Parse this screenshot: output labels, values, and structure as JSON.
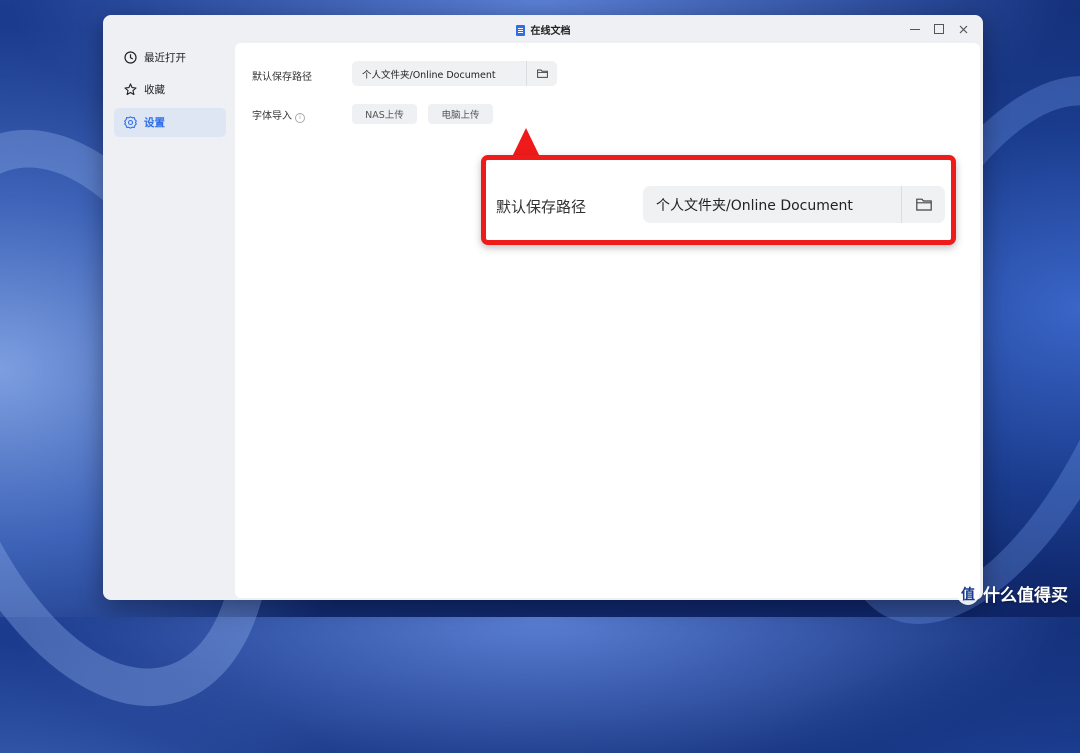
{
  "window": {
    "title": "在线文档"
  },
  "sidebar": {
    "items": [
      {
        "label": "最近打开",
        "icon": "clock-icon",
        "active": false
      },
      {
        "label": "收藏",
        "icon": "star-icon",
        "active": false
      },
      {
        "label": "设置",
        "icon": "gear-icon",
        "active": true
      }
    ]
  },
  "settings": {
    "save_path_label": "默认保存路径",
    "save_path_value": "个人文件夹/Online Document",
    "font_import_label": "字体导入",
    "nas_upload_label": "NAS上传",
    "pc_upload_label": "电脑上传"
  },
  "callout": {
    "label": "默认保存路径",
    "value": "个人文件夹/Online Document",
    "border_color": "#ef1b1b"
  },
  "watermark": {
    "icon_text": "值",
    "text": "什么值得买"
  },
  "colors": {
    "accent": "#2f6ee8",
    "highlight": "#ef1b1b"
  }
}
